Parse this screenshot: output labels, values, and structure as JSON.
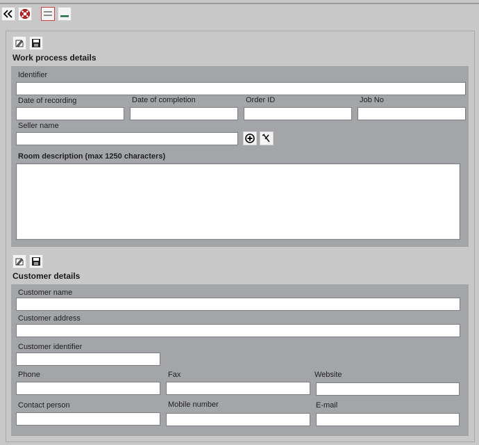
{
  "toolbar": {
    "collapse_icon": "double-chevron-left-icon",
    "help_icon": "lifebuoy-icon",
    "layout_icon": "equals-layout-icon",
    "minimize_icon": "minimize-icon"
  },
  "work_process": {
    "title": "Work process details",
    "identifier_label": "Identifier",
    "identifier_value": "",
    "date_recording_label": "Date of recording",
    "date_recording_value": "",
    "date_completion_label": "Date of completion",
    "date_completion_value": "",
    "order_id_label": "Order ID",
    "order_id_value": "",
    "job_no_label": "Job No",
    "job_no_value": "",
    "seller_name_label": "Seller name",
    "seller_name_value": "",
    "room_description_label": "Room description (max 1250 characters)",
    "room_description_value": ""
  },
  "customer": {
    "title": "Customer details",
    "customer_name_label": "Customer name",
    "customer_name_value": "",
    "customer_address_label": "Customer address",
    "customer_address_value": "",
    "customer_identifier_label": "Customer identifier",
    "customer_identifier_value": "",
    "phone_label": "Phone",
    "phone_value": "",
    "fax_label": "Fax",
    "fax_value": "",
    "website_label": "Website",
    "website_value": "",
    "contact_person_label": "Contact person",
    "contact_person_value": "",
    "mobile_label": "Mobile number",
    "mobile_value": "",
    "email_label": "E-mail",
    "email_value": ""
  }
}
